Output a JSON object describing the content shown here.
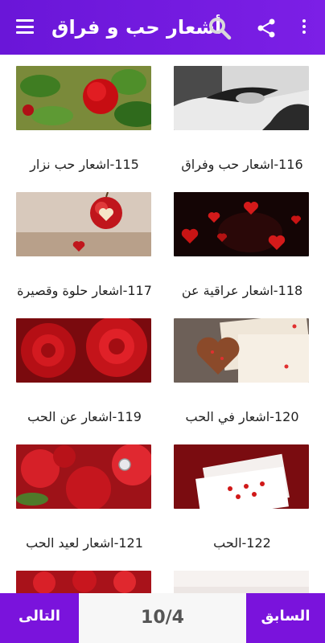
{
  "header": {
    "title": "أشعار حب و فراق",
    "icons": [
      "menu-icon",
      "search-icon",
      "share-icon",
      "more-vert-icon"
    ]
  },
  "colors": {
    "primary": "#7a13dc",
    "title_text": "#ffffff",
    "page_bg": "#ffffff"
  },
  "grid": {
    "items": [
      {
        "label": "116-اشعار حب وفراق",
        "image": "hands-couple-photo"
      },
      {
        "label": "115-اشعار حب نزار",
        "image": "red-rose-leaves-photo"
      },
      {
        "label": "118-اشعار عراقية عن",
        "image": "red-hearts-dark-photo"
      },
      {
        "label": "117-اشعار حلوة وقصيرة",
        "image": "apple-heart-photo"
      },
      {
        "label": "120-اشعار في الحب",
        "image": "heart-cookie-letter-photo"
      },
      {
        "label": "119-اشعار عن الحب",
        "image": "red-roses-photo"
      },
      {
        "label": "122-الحب",
        "image": "playing-cards-photo"
      },
      {
        "label": "121-اشعار لعيد الحب",
        "image": "roses-ring-photo"
      },
      {
        "label": "",
        "image": "partial-light-photo"
      },
      {
        "label": "",
        "image": "partial-roses-photo"
      }
    ]
  },
  "pagination": {
    "next_label": "التالى",
    "prev_label": "السابق",
    "page_indicator": "10/4"
  }
}
